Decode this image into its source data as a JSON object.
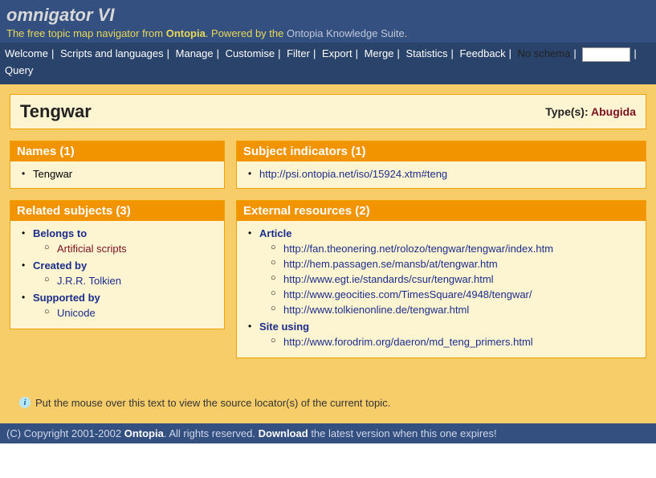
{
  "header": {
    "title": "omnigator VI",
    "subtitle_prefix": "The free topic map navigator from ",
    "subtitle_brand": "Ontopia",
    "subtitle_mid": ". Powered by the ",
    "subtitle_suite": "Ontopia Knowledge Suite",
    "subtitle_end": "."
  },
  "nav": {
    "items": [
      "Welcome",
      "Scripts and languages",
      "Manage",
      "Customise",
      "Filter",
      "Export",
      "Merge",
      "Statistics",
      "Feedback"
    ],
    "noschema": "No schema",
    "query": "Query"
  },
  "page": {
    "title": "Tengwar",
    "type_label": "Type(s): ",
    "type_value": "Abugida"
  },
  "panels": {
    "names": {
      "header": "Names (1)",
      "item": "Tengwar"
    },
    "related": {
      "header": "Related subjects (3)",
      "items": [
        {
          "label": "Belongs to",
          "sub": {
            "text": "Artificial scripts",
            "dark": true
          }
        },
        {
          "label": "Created by",
          "sub": {
            "text": "J.R.R. Tolkien",
            "dark": false
          }
        },
        {
          "label": "Supported by",
          "sub": {
            "text": "Unicode",
            "dark": false
          }
        }
      ]
    },
    "subjind": {
      "header": "Subject indicators (1)",
      "link": "http://psi.ontopia.net/iso/15924.xtm#teng"
    },
    "external": {
      "header": "External resources (2)",
      "article_label": "Article",
      "articles": [
        "http://fan.theonering.net/rolozo/tengwar/tengwar/index.htm",
        "http://hem.passagen.se/mansb/at/tengwar.htm",
        "http://www.egt.ie/standards/csur/tengwar.html",
        "http://www.geocities.com/TimesSquare/4948/tengwar/",
        "http://www.tolkienonline.de/tengwar.html"
      ],
      "siteusing_label": "Site using",
      "siteusing": [
        "http://www.forodrim.org/daeron/md_teng_primers.html"
      ]
    }
  },
  "info": "Put the mouse over this text to view the source locator(s) of the current topic.",
  "footer": {
    "copyright_prefix": "(C) Copyright 2001-2002 ",
    "brand": "Ontopia",
    "mid": ". All rights reserved. ",
    "download": "Download",
    "tail": " the latest version when this one expires!"
  }
}
